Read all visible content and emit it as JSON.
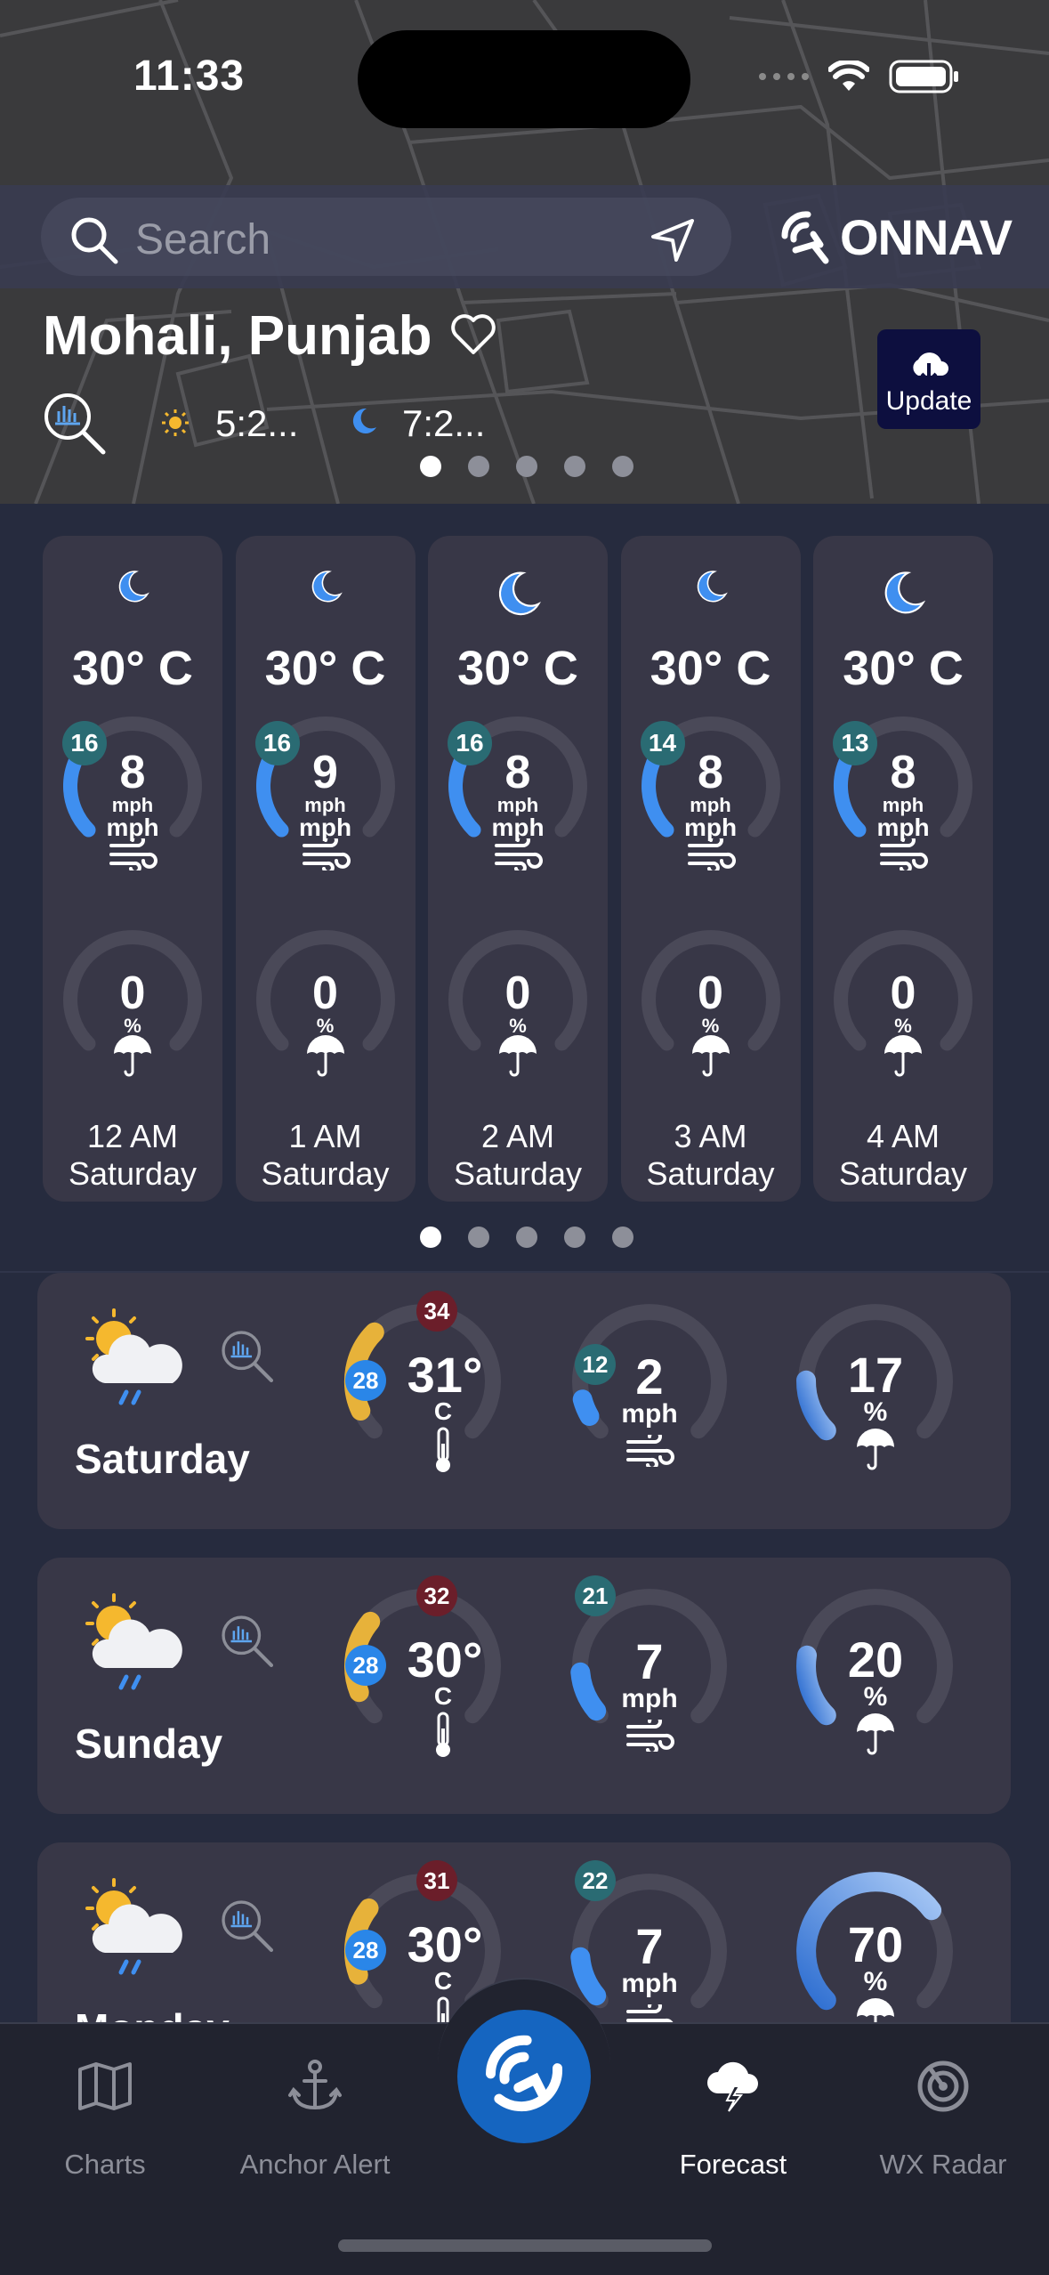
{
  "status_bar": {
    "time": "11:33"
  },
  "search": {
    "placeholder": "Search"
  },
  "brand": {
    "name": "ONNAV"
  },
  "location": {
    "title": "Mohali, Punjab",
    "sunrise": "5:2...",
    "sunset": "7:2...",
    "update_label": "Update"
  },
  "pager_top": {
    "count": 5,
    "active": 0
  },
  "hourly": [
    {
      "temp": "30° C",
      "gust": "16",
      "wind": "8",
      "wind_unit_small": "mph",
      "wind_unit": "mph",
      "precip": "0",
      "precip_unit": "%",
      "time": "12 AM",
      "day": "Saturday"
    },
    {
      "temp": "30° C",
      "gust": "16",
      "wind": "9",
      "wind_unit_small": "mph",
      "wind_unit": "mph",
      "precip": "0",
      "precip_unit": "%",
      "time": "1 AM",
      "day": "Saturday"
    },
    {
      "temp": "30° C",
      "gust": "16",
      "wind": "8",
      "wind_unit_small": "mph",
      "wind_unit": "mph",
      "precip": "0",
      "precip_unit": "%",
      "time": "2 AM",
      "day": "Saturday"
    },
    {
      "temp": "30° C",
      "gust": "14",
      "wind": "8",
      "wind_unit_small": "mph",
      "wind_unit": "mph",
      "precip": "0",
      "precip_unit": "%",
      "time": "3 AM",
      "day": "Saturday"
    },
    {
      "temp": "30° C",
      "gust": "13",
      "wind": "8",
      "wind_unit_small": "mph",
      "wind_unit": "mph",
      "precip": "0",
      "precip_unit": "%",
      "time": "4 AM",
      "day": "Saturday"
    }
  ],
  "pager_hourly": {
    "count": 5,
    "active": 0
  },
  "daily": [
    {
      "day": "Saturday",
      "high": "34",
      "low": "28",
      "temp": "31°",
      "temp_unit": "C",
      "gust": "12",
      "wind": "2",
      "wind_unit": "mph",
      "precip": "17",
      "precip_unit": "%",
      "precip_fraction": 0.17
    },
    {
      "day": "Sunday",
      "high": "32",
      "low": "28",
      "temp": "30°",
      "temp_unit": "C",
      "gust": "21",
      "wind": "7",
      "wind_unit": "mph",
      "precip": "20",
      "precip_unit": "%",
      "precip_fraction": 0.2
    },
    {
      "day": "Monday",
      "high": "31",
      "low": "28",
      "temp": "30°",
      "temp_unit": "C",
      "gust": "22",
      "wind": "7",
      "wind_unit": "mph",
      "precip": "70",
      "precip_unit": "%",
      "precip_fraction": 0.7
    }
  ],
  "tabs": [
    {
      "label": "Charts",
      "icon": "map-icon",
      "active": false
    },
    {
      "label": "Anchor Alert",
      "icon": "anchor-icon",
      "active": false
    },
    {
      "label": "Forecast",
      "icon": "storm-cloud-icon",
      "active": true
    },
    {
      "label": "WX Radar",
      "icon": "radar-icon",
      "active": false
    }
  ],
  "colors": {
    "accent": "#1565c0",
    "card": "#383747",
    "background": "#262b3e",
    "high_badge": "#6b1e2a",
    "low_badge": "#2a86e8",
    "gust_badge": "#2a6b73"
  }
}
